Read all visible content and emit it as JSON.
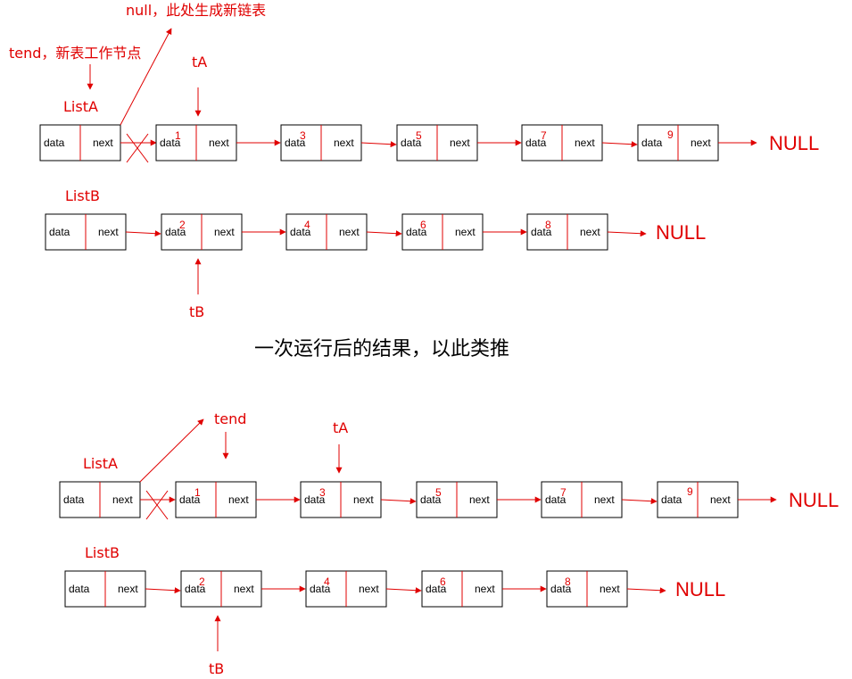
{
  "labels": {
    "null_new_list": "null，此处生成新链表",
    "tend_working": "tend，新表工作节点",
    "tend": "tend",
    "ta": "tA",
    "tb": "tB",
    "list_a": "ListA",
    "list_b": "ListB",
    "null": "NULL",
    "caption": "一次运行后的结果，以此类推"
  },
  "node": {
    "data": "data",
    "next": "next"
  },
  "list_a_values": [
    "1",
    "3",
    "5",
    "7",
    "9"
  ],
  "list_b_values": [
    "2",
    "4",
    "6",
    "8"
  ],
  "colors": {
    "accent": "#e00000",
    "border": "#000000",
    "background": "#ffffff"
  }
}
